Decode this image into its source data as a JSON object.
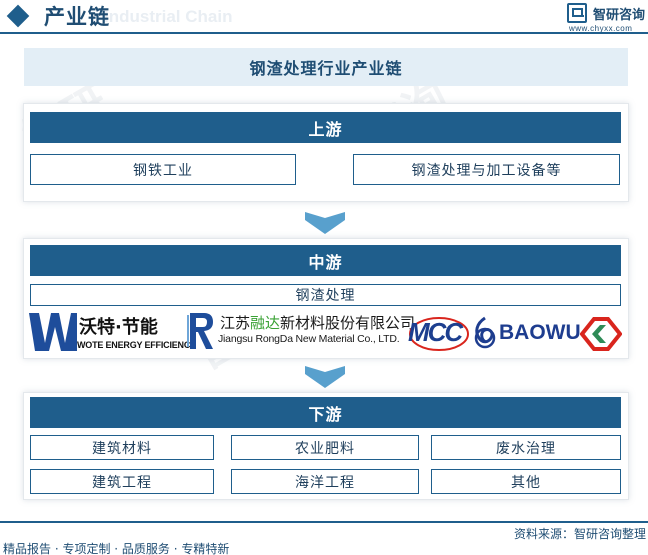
{
  "header": {
    "title": "产业链",
    "ghost_text": "Industrial Chain",
    "brand_name": "智研咨询",
    "brand_url": "www.chyxx.com"
  },
  "diagram": {
    "title": "钢渣处理行业产业链",
    "upstream": {
      "label": "上游",
      "items": [
        "钢铁工业",
        "钢渣处理与加工设备等"
      ]
    },
    "midstream": {
      "label": "中游",
      "item": "钢渣处理",
      "logos": [
        {
          "name": "沃特·节能",
          "sub": "WOTE ENERGY EFFICIENCY"
        },
        {
          "name_pre": "江苏",
          "name_green": "融达",
          "name_post": "新材料股份有限公司",
          "sub": "Jiangsu RongDa New Material Co., LTD."
        },
        {
          "name": "MCC"
        },
        {
          "name": "BAOWU"
        }
      ]
    },
    "downstream": {
      "label": "下游",
      "items": [
        "建筑材料",
        "农业肥料",
        "废水治理",
        "建筑工程",
        "海洋工程",
        "其他"
      ]
    }
  },
  "colors": {
    "primary": "#1f5e8c",
    "title_bg": "#e3eef6",
    "arrow": "#3b8fc4",
    "rongda_green": "#3aa235",
    "mcc_blue": "#1d3f8f",
    "mcc_red": "#d9251d"
  },
  "footer": {
    "source": "资料来源：智研咨询整理",
    "slogan": "精品报告 · 专项定制 · 品质服务 · 专精特新"
  }
}
